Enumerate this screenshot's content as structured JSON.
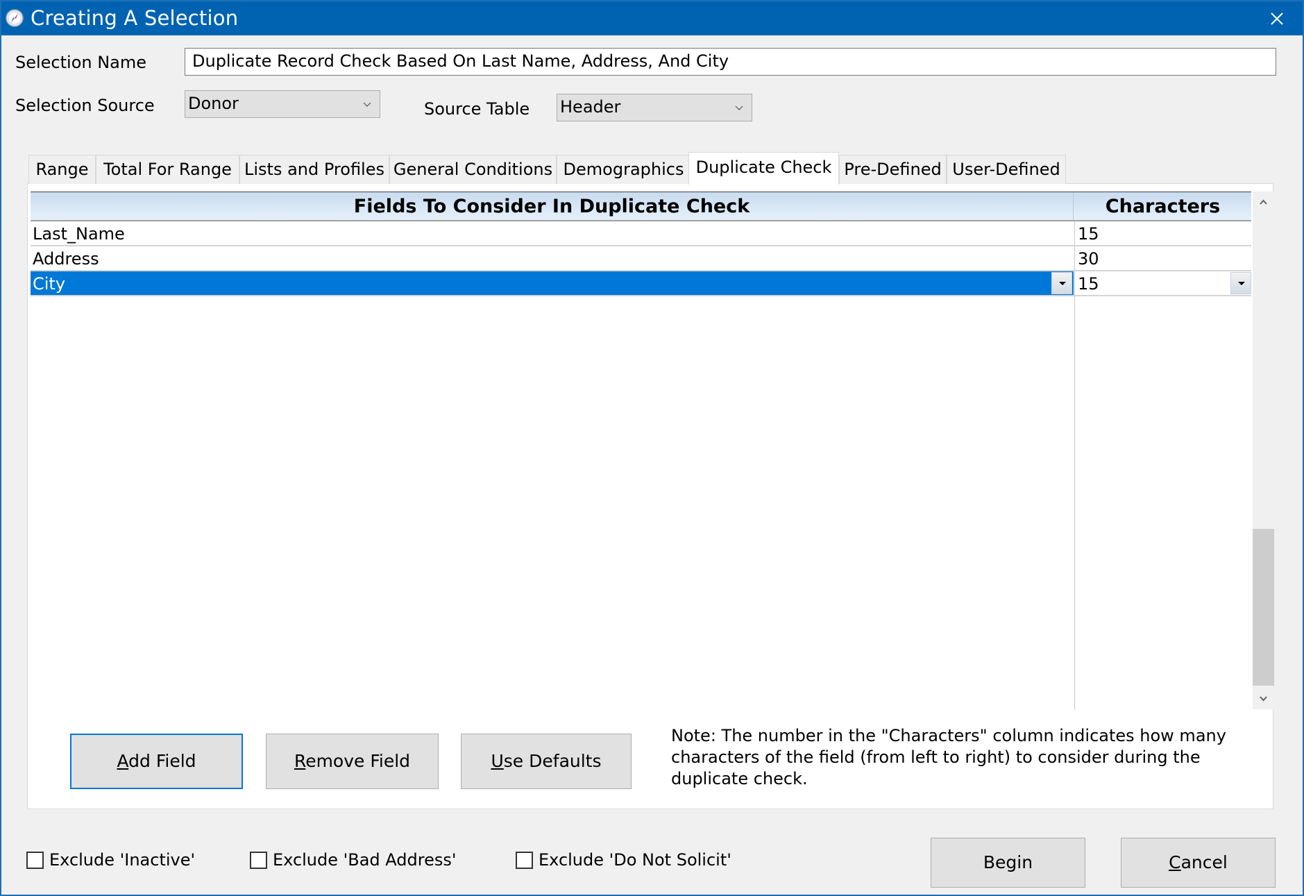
{
  "window": {
    "title": "Creating A Selection",
    "title_bar_color": "#0063B1",
    "icon": "compass-icon",
    "close_icon": "close-icon"
  },
  "form": {
    "selection_name_label": "Selection Name",
    "selection_name_value": "Duplicate Record Check Based On Last Name, Address, And City",
    "selection_source_label": "Selection Source",
    "selection_source_value": "Donor",
    "source_table_label": "Source Table",
    "source_table_value": "Header"
  },
  "tabs": [
    {
      "label": "Range",
      "active": false
    },
    {
      "label": "Total For Range",
      "active": false
    },
    {
      "label": "Lists and Profiles",
      "active": false
    },
    {
      "label": "General Conditions",
      "active": false
    },
    {
      "label": "Demographics",
      "active": false
    },
    {
      "label": "Duplicate Check",
      "active": true
    },
    {
      "label": "Pre-Defined",
      "active": false
    },
    {
      "label": "User-Defined",
      "active": false
    }
  ],
  "grid": {
    "columns": [
      "Fields To Consider In Duplicate Check",
      "Characters"
    ],
    "rows": [
      {
        "field": "Last_Name",
        "characters": "15",
        "selected": false
      },
      {
        "field": "Address",
        "characters": "30",
        "selected": false
      },
      {
        "field": "City",
        "characters": "15",
        "selected": true
      }
    ],
    "selection_color": "#0078D7"
  },
  "buttons": {
    "add_field": {
      "prefix": "A",
      "rest": "dd Field"
    },
    "remove_field": {
      "prefix": "R",
      "rest": "emove Field"
    },
    "use_defaults": {
      "prefix": "U",
      "rest": "se Defaults"
    },
    "begin": "Begin",
    "cancel": {
      "prefix": "C",
      "rest": "ancel"
    }
  },
  "note": "Note:  The number in the \"Characters\" column indicates how many characters of the field (from left to right) to consider during the duplicate check.",
  "checkboxes": [
    {
      "label": "Exclude 'Inactive'",
      "checked": false
    },
    {
      "label": "Exclude 'Bad Address'",
      "checked": false
    },
    {
      "label": "Exclude 'Do Not Solicit'",
      "checked": false
    }
  ]
}
